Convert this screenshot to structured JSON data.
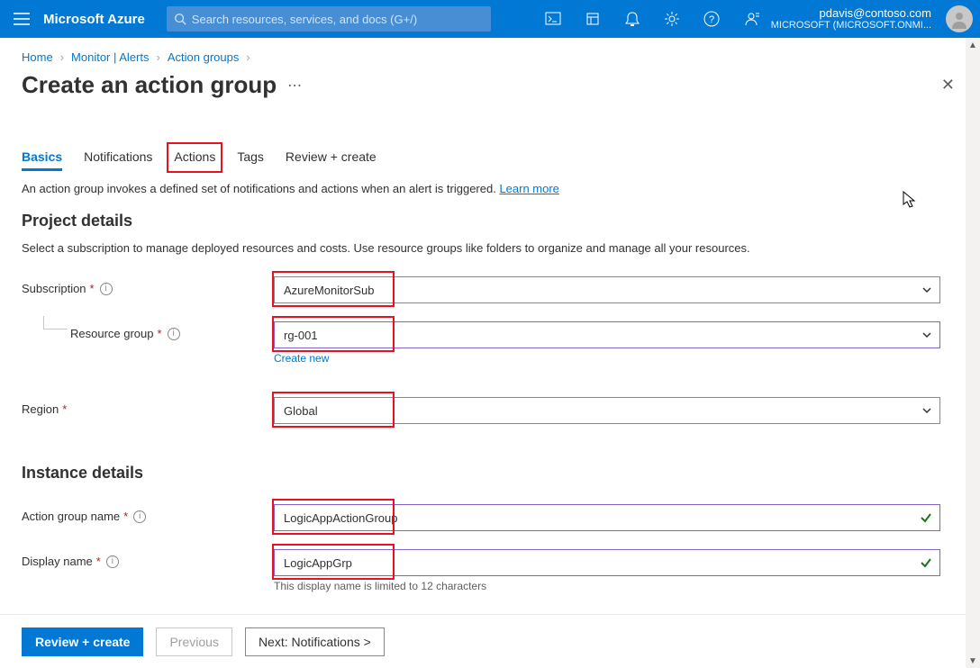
{
  "topbar": {
    "brand": "Microsoft Azure",
    "search_placeholder": "Search resources, services, and docs (G+/)",
    "account_email": "pdavis@contoso.com",
    "account_org": "MICROSOFT (MICROSOFT.ONMI..."
  },
  "breadcrumb": {
    "items": [
      "Home",
      "Monitor | Alerts",
      "Action groups"
    ]
  },
  "page": {
    "title": "Create an action group"
  },
  "tabs": {
    "items": [
      "Basics",
      "Notifications",
      "Actions",
      "Tags",
      "Review + create"
    ],
    "active_index": 0,
    "highlighted_index": 2
  },
  "description": {
    "text": "An action group invokes a defined set of notifications and actions when an alert is triggered. ",
    "link": "Learn more"
  },
  "project_details": {
    "heading": "Project details",
    "note": "Select a subscription to manage deployed resources and costs. Use resource groups like folders to organize and manage all your resources.",
    "subscription_label": "Subscription",
    "subscription_value": "AzureMonitorSub",
    "resource_group_label": "Resource group",
    "resource_group_value": "rg-001",
    "create_new": "Create new",
    "region_label": "Region",
    "region_value": "Global"
  },
  "instance_details": {
    "heading": "Instance details",
    "action_group_name_label": "Action group name",
    "action_group_name_value": "LogicAppActionGroup",
    "display_name_label": "Display name",
    "display_name_value": "LogicAppGrp",
    "display_name_hint": "This display name is limited to 12 characters"
  },
  "footer": {
    "review": "Review + create",
    "previous": "Previous",
    "next": "Next: Notifications >"
  }
}
